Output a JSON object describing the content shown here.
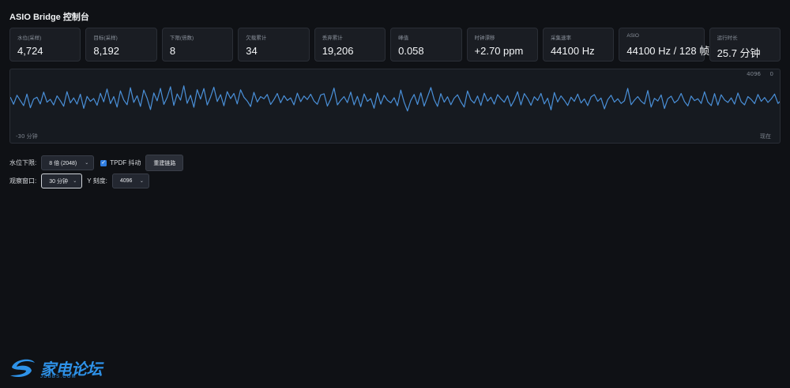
{
  "app": {
    "title": "ASIO Bridge 控制台"
  },
  "stats": [
    {
      "label": "水位(采样)",
      "value": "4,724"
    },
    {
      "label": "目标(采样)",
      "value": "8,192"
    },
    {
      "label": "下限(倍数)",
      "value": "8"
    },
    {
      "label": "欠载累计",
      "value": "34"
    },
    {
      "label": "丢弃累计",
      "value": "19,206"
    },
    {
      "label": "峰值",
      "value": "0.058"
    },
    {
      "label": "时钟漂移",
      "value": "+2.70 ppm"
    },
    {
      "label": "采集速率",
      "value": "44100 Hz"
    },
    {
      "label": "ASIO",
      "value": "44100 Hz / 128 帧"
    },
    {
      "label": "运行时长",
      "value": "25.7 分钟"
    }
  ],
  "chart_data": {
    "type": "line",
    "title": "",
    "x_start_label": "-30 分钟",
    "x_end_label": "现在",
    "y_top_label": "4096",
    "y_zero_label": "0",
    "ylim": [
      0,
      4096
    ],
    "color": "#4a90d9",
    "series": [
      {
        "values": [
          2690,
          2220,
          2810,
          2470,
          2130,
          2890,
          1990,
          2560,
          2680,
          2240,
          3020,
          2360,
          2540,
          2170,
          2770,
          2450,
          2090,
          3050,
          2310,
          2640,
          2230,
          2880,
          1950,
          2730,
          2410,
          2600,
          2150,
          2940,
          2380,
          3220,
          2260,
          2720,
          2030,
          3100,
          2500,
          2190,
          3310,
          2340,
          2780,
          2080,
          3150,
          2620,
          1870,
          2960,
          2440,
          3260,
          2210,
          2670,
          3370,
          2140,
          2900,
          2490,
          3430,
          2280,
          2810,
          2020,
          3180,
          2560,
          3250,
          2170,
          2690,
          3340,
          2400,
          2850,
          2120,
          3050,
          2590,
          2930,
          2240,
          3170,
          2680,
          2430,
          2070,
          3000,
          2370,
          2720,
          2580,
          2860,
          2210,
          2530,
          2930,
          2320,
          2780,
          2470,
          2640,
          2180,
          2950,
          2390,
          2760,
          2530,
          2880,
          2430,
          2220,
          2830,
          2910,
          2100,
          2560,
          3280,
          2180,
          2480,
          2720,
          2330,
          3020,
          2180,
          2740,
          2060,
          2900,
          2410,
          2590,
          1960,
          2970,
          2230,
          2810,
          2480,
          2310,
          2650,
          2120,
          3150,
          2350,
          1780,
          2470,
          2860,
          2210,
          2970,
          2100,
          2690,
          3320,
          2530,
          2080,
          2920,
          2360,
          2710,
          2190,
          2620,
          2840,
          2380,
          2030,
          3090,
          2510,
          2290,
          2760,
          2140,
          2940,
          2420,
          2680,
          2230,
          2850,
          2580,
          2350,
          2780,
          2090,
          2490,
          3040,
          2180,
          2920,
          2600,
          2150,
          2710,
          2470,
          2930,
          2240,
          2620,
          1850,
          2990,
          2370,
          2770,
          2480,
          2140,
          2680,
          2410,
          2890,
          2300,
          2570,
          2130,
          2700,
          2850,
          2410,
          2630,
          1920,
          2520,
          2810,
          2360,
          2580,
          2270,
          2440,
          3260,
          2190,
          2490,
          2720,
          2420,
          2240,
          3120,
          2030,
          2610,
          2430,
          2830,
          1940,
          2580,
          2750,
          2310,
          2490,
          2930,
          2390,
          2110,
          2760,
          2460,
          2580,
          2270,
          3040,
          2370,
          2130,
          2920,
          2160,
          2840,
          2500,
          2340,
          2640,
          2230,
          2960,
          2380,
          2180,
          2720,
          2530,
          2260,
          2860,
          2410,
          2660,
          2340,
          2570,
          2890,
          2270,
          2490
        ]
      }
    ]
  },
  "controls": {
    "low_limit_label": "水位下限:",
    "low_limit_value": "8 倍 (2048)",
    "tpdf_label": "TPDF 抖动",
    "tpdf_checked": true,
    "rebuild_label": "重建链路",
    "window_label": "观察窗口:",
    "window_value": "30 分钟",
    "yscale_label": "Y 刻度:",
    "yscale_value": "4096"
  },
  "watermark": {
    "text": "家电论坛",
    "sub": "JDBBS.COM",
    "color": "#2e92e8"
  }
}
